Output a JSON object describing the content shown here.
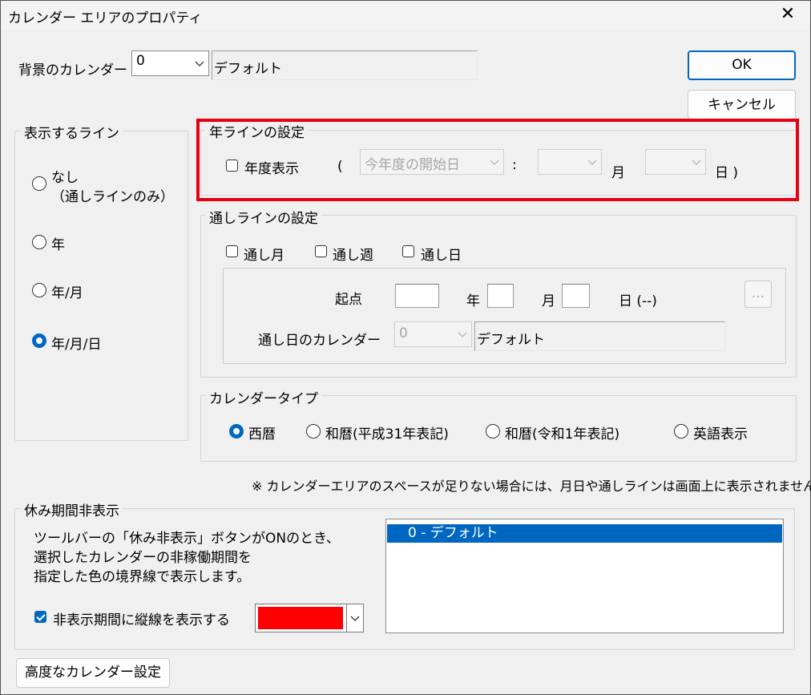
{
  "window": {
    "title": "カレンダー エリアのプロパティ"
  },
  "icons": {
    "close": "close-icon",
    "dropdown": "chevron-down-icon"
  },
  "colors": {
    "accent": "#0067c0",
    "highlight_frame": "#e60012",
    "selected_color": "#ff0000"
  },
  "bg_calendar": {
    "label": "背景のカレンダー",
    "number": "0",
    "name": "デフォルト"
  },
  "buttons": {
    "ok": "OK",
    "cancel": "キャンセル",
    "advanced": "高度なカレンダー設定",
    "ellipsis": "..."
  },
  "display_line": {
    "title": "表示するライン",
    "options": [
      {
        "label": "なし",
        "sub": "（通しラインのみ）",
        "checked": false
      },
      {
        "label": "年",
        "checked": false
      },
      {
        "label": "年/月",
        "checked": false
      },
      {
        "label": "年/月/日",
        "checked": true
      }
    ]
  },
  "year_line": {
    "title": "年ラインの設定",
    "fiscal_label": "年度表示",
    "fiscal_checked": false,
    "open_paren": "(",
    "start_combo": "今年度の開始日",
    "colon": ":",
    "month_label": "月",
    "day_close": "日 )"
  },
  "through_line": {
    "title": "通しラインの設定",
    "checks": [
      {
        "label": "通し月",
        "checked": false
      },
      {
        "label": "通し週",
        "checked": false
      },
      {
        "label": "通し日",
        "checked": false
      }
    ],
    "origin_label": "起点",
    "year_label": "年",
    "month_label": "月",
    "day_label": "日 (--)",
    "calendar_label": "通し日のカレンダー",
    "calendar_number": "0",
    "calendar_name": "デフォルト"
  },
  "calendar_type": {
    "title": "カレンダータイプ",
    "options": [
      {
        "label": "西暦",
        "checked": true
      },
      {
        "label": "和暦(平成31年表記)",
        "checked": false
      },
      {
        "label": "和暦(令和1年表記)",
        "checked": false
      },
      {
        "label": "英語表示",
        "checked": false
      }
    ]
  },
  "note": "※ カレンダーエリアのスペースが足りない場合には、月日や通しラインは画面上に表示されません。",
  "holiday": {
    "title": "休み期間非表示",
    "desc_lines": [
      "ツールバーの「休み非表示」ボタンがONのとき、",
      "選択したカレンダーの非稼働期間を",
      "指定した色の境界線で表示します。"
    ],
    "vline_label": "非表示期間に縦線を表示する",
    "vline_checked": true,
    "list_items": [
      "0 - デフォルト"
    ]
  }
}
